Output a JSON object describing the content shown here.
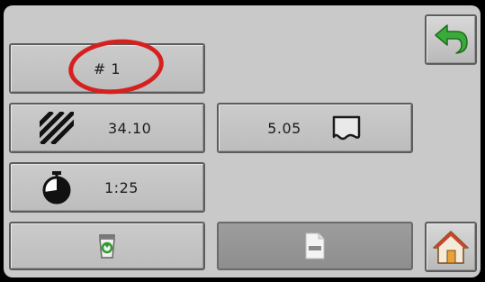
{
  "record_button": {
    "label": "# 1"
  },
  "area_button": {
    "icon": "hatched-area-icon",
    "value": "34.10"
  },
  "distance_button": {
    "value": "5.05",
    "icon": "boundary-outline-icon"
  },
  "time_button": {
    "icon": "stopwatch-icon",
    "value": "1:25"
  },
  "delete_button": {
    "icon": "recycle-bin-icon"
  },
  "report_button": {
    "icon": "document-icon"
  },
  "back_button": {
    "icon": "back-arrow-icon",
    "accent": "#3aaa3a"
  },
  "home_button": {
    "icon": "home-icon",
    "accent": "#e8a23a"
  },
  "highlight": {
    "color": "#d62020"
  }
}
